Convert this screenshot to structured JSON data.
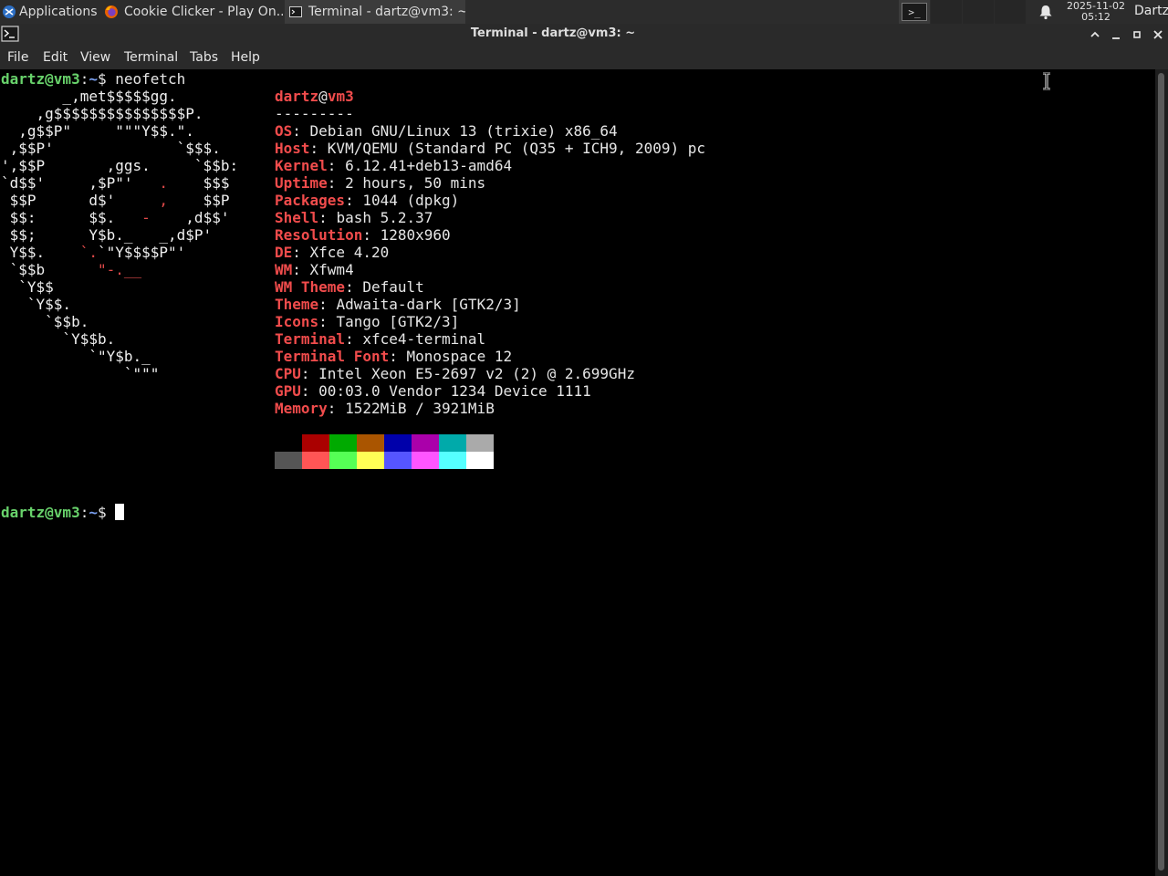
{
  "panel": {
    "applications_label": "Applications ☰",
    "tasks": [
      {
        "label": "Cookie Clicker - Play On...",
        "icon": "firefox-icon"
      },
      {
        "label": "Terminal - dartz@vm3: ~",
        "icon": "terminal-icon"
      }
    ],
    "workspace_icon": ">_",
    "clock_date": "2025-11-02",
    "clock_time": "05:12",
    "user": "Dartz"
  },
  "window": {
    "title": "Terminal - dartz@vm3: ~",
    "controls": [
      "roll-up",
      "minimize",
      "maximize",
      "close"
    ]
  },
  "menubar": [
    "File",
    "Edit",
    "View",
    "Terminal",
    "Tabs",
    "Help"
  ],
  "terminal": {
    "prompt_user": "dartz@vm3",
    "prompt_colon": ":",
    "prompt_dir": "~",
    "prompt_dollar": "$ ",
    "command": "neofetch",
    "logo": [
      "       _,met$$$$$gg.",
      "    ,g$$$$$$$$$$$$$$$P.",
      "  ,g$$P\"     \"\"\"Y$$.\".",
      " ,$$P'              `$$$.",
      "',$$P       ,ggs.     `$$b:",
      "`d$$'     ,$P\"'   .    $$$",
      " $$P      d$'     ,    $$P",
      " $$:      $$.   -    ,d$$'",
      " $$;      Y$b._   _,d$P'",
      " Y$$.    `.`\"Y$$$$P\"'",
      " `$$b      \"-.__",
      "  `Y$$",
      "   `Y$$.",
      "     `$$b.",
      "       `Y$$b.",
      "          `\"Y$b._",
      "              `\"\"\""
    ],
    "header_user": "dartz",
    "header_at": "@",
    "header_host": "vm3",
    "separator": "---------",
    "info": [
      {
        "key": "OS",
        "value": "Debian GNU/Linux 13 (trixie) x86_64"
      },
      {
        "key": "Host",
        "value": "KVM/QEMU (Standard PC (Q35 + ICH9, 2009) pc"
      },
      {
        "key": "Kernel",
        "value": "6.12.41+deb13-amd64"
      },
      {
        "key": "Uptime",
        "value": "2 hours, 50 mins"
      },
      {
        "key": "Packages",
        "value": "1044 (dpkg)"
      },
      {
        "key": "Shell",
        "value": "bash 5.2.37"
      },
      {
        "key": "Resolution",
        "value": "1280x960"
      },
      {
        "key": "DE",
        "value": "Xfce 4.20"
      },
      {
        "key": "WM",
        "value": "Xfwm4"
      },
      {
        "key": "WM Theme",
        "value": "Default"
      },
      {
        "key": "Theme",
        "value": "Adwaita-dark [GTK2/3]"
      },
      {
        "key": "Icons",
        "value": "Tango [GTK2/3]"
      },
      {
        "key": "Terminal",
        "value": "xfce4-terminal"
      },
      {
        "key": "Terminal Font",
        "value": "Monospace 12"
      },
      {
        "key": "CPU",
        "value": "Intel Xeon E5-2697 v2 (2) @ 2.699GHz"
      },
      {
        "key": "GPU",
        "value": "00:03.0 Vendor 1234 Device 1111"
      },
      {
        "key": "Memory",
        "value": "1522MiB / 3921MiB"
      }
    ],
    "palette_row1": [
      "#000000",
      "#aa0000",
      "#00aa00",
      "#aa5500",
      "#0000aa",
      "#aa00aa",
      "#00aaaa",
      "#aaaaaa"
    ],
    "palette_row2": [
      "#555555",
      "#ff5555",
      "#55ff55",
      "#ffff55",
      "#5555ff",
      "#ff55ff",
      "#55ffff",
      "#ffffff"
    ]
  }
}
